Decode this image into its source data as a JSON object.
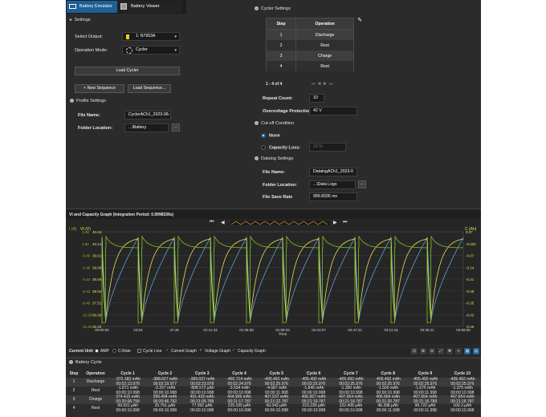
{
  "tabs": [
    {
      "label": "Battery Emulator",
      "active": true
    },
    {
      "label": "Battery Viewer",
      "active": false
    }
  ],
  "left": {
    "settings_header": "Settings",
    "select_output_label": "Select Output:",
    "select_output_value": "1: N7953A",
    "operation_mode_label": "Operation Mode:",
    "operation_mode_value": "Cycler",
    "load_cycler": "Load Cycler",
    "new_sequence": "+ New Sequence",
    "load_sequence": "Load Sequence...",
    "profile_settings": "Profile Settings",
    "file_name_label": "File Name:",
    "file_name_value": "CyclerACh1_2023-06-",
    "folder_location_label": "Folder Location:",
    "folder_location_value": "...\\Battery",
    "browse": "..."
  },
  "cycler": {
    "header": "Cycler Settings",
    "columns": [
      "Step",
      "Operation"
    ],
    "rows": [
      [
        "1",
        "Discharge"
      ],
      [
        "2",
        "Rest"
      ],
      [
        "3",
        "Charge"
      ],
      [
        "4",
        "Rest"
      ]
    ],
    "pager_text": "1 - 4 of 4",
    "repeat_count_label": "Repeat Count:",
    "repeat_count_value": "10",
    "overvoltage_label": "Overvoltage Protection:",
    "overvoltage_value": "42 V",
    "cutoff_header": "Cut-off Condition",
    "none_label": "None",
    "capacity_loss_label": "Capacity Loss:",
    "capacity_loss_value": "10 %",
    "datalog_header": "Datalog Settings",
    "dl_file_name_label": "File Name:",
    "dl_file_name_value": "DatalogACh1_2023-0",
    "dl_folder_label": "Folder Location:",
    "dl_folder_value": "...\\Data Logs",
    "file_save_rate_label": "File Save Rate",
    "file_save_rate_value": "999.8336 ms"
  },
  "graph": {
    "title": "VI and Capacity Graph (Integration Period: 0.9998336s)",
    "left_axis_1_title": "I (A)",
    "left_axis_2_title": "Vt (V)",
    "right_axis_title": "C (Ah)",
    "i_ticks": [
      "3.48",
      "1.50",
      "-0.48",
      "-2.46",
      "-4.44",
      "-6.42",
      "-8.40",
      "-10.38",
      "-11.92"
    ],
    "v_ticks": [
      "40.66",
      "40.14",
      "39.61",
      "39.09",
      "38.56",
      "38.04",
      "37.51",
      "36.99",
      "36.49"
    ],
    "c_ticks": [
      "0.07",
      "-0.002",
      "-0.07",
      "-0.14",
      "-0.21",
      "-0.28",
      "-0.35",
      "-0.42",
      "-0.46"
    ],
    "x_ticks": [
      "00:00:00",
      "23:04",
      "47:49",
      "01:11:43",
      "01:35:38",
      "01:59:33",
      "02:23:27",
      "02:47:21",
      "03:11:16",
      "03:35:11",
      "03:59:05"
    ],
    "x_label": "Time",
    "colors": {
      "current": "#7fc31e",
      "voltage": "#e3e05a",
      "capacity": "#5a9fd8"
    }
  },
  "legend": {
    "current_unit_label": "Current Unit:",
    "amp": "AMP",
    "crate": "C-Rate",
    "cycle_line": "Cycle Line",
    "current_graph": "Current Graph",
    "voltage_graph": "Voltage Graph",
    "capacity_graph": "Capacity Graph"
  },
  "battery_cycle": {
    "header": "Battery Cycle",
    "columns": [
      "Step",
      "Operation",
      "Cycle 1",
      "Cycle 2",
      "Cycle 3",
      "Cycle 4",
      "Cycle 5",
      "Cycle 6",
      "Cycle 7",
      "Cycle 8",
      "Cycle 9",
      "Cycle 10"
    ],
    "rows": [
      {
        "step": "1",
        "op": "Discharge",
        "cells": [
          [
            "-372.183 mAh",
            "00:02:13.978"
          ],
          [
            "-388.627 mAh",
            "00:02:19.977"
          ],
          [
            "-399.037 mAh",
            "00:02:23.978"
          ],
          [
            "-402.714 mAh",
            "00:02:24.976"
          ],
          [
            "-405.492 mAh",
            "00:02:25.976"
          ],
          [
            "-405.492 mAh",
            "00:02:25.976"
          ],
          [
            "-405.492 mAh",
            "00:02:25.976"
          ],
          [
            "-405.492 mAh",
            "00:02:25.976"
          ],
          [
            "-405.492 mAh",
            "00:02:25.976"
          ],
          [
            "-405.492 mAh",
            "00:02:25.976"
          ]
        ]
      },
      {
        "step": "2",
        "op": "Rest",
        "cells": [
          [
            "-1.871 mAh",
            "00:00:10.998"
          ],
          [
            "-3.257 mAh",
            "00:00:10.998"
          ],
          [
            "-808.572 µAh",
            "00:00:10.998"
          ],
          [
            "-3.534 mAh",
            "00:00:10.998"
          ],
          [
            "-4.687 mAh",
            "00:00:11.998"
          ],
          [
            "-1.845 mAh",
            "00:00:10.998"
          ],
          [
            "-1.350 mAh",
            "00:00:10.998"
          ],
          [
            "-1.500 mAh",
            "00:00:10.998"
          ],
          [
            "-1.675 mAh",
            "00:00:11.998"
          ],
          [
            "-1.375 mAh",
            "00:00:10.998"
          ]
        ]
      },
      {
        "step": "3",
        "op": "Charge",
        "cells": [
          [
            "374.415 mAh",
            "00:20:08.799"
          ],
          [
            "399.494 mAh",
            "00:20:46.792"
          ],
          [
            "401.418 mAh",
            "00:21:09.789"
          ],
          [
            "404.999 mAh",
            "00:21:17.787"
          ],
          [
            "407.537 mAh",
            "00:21:22.787"
          ],
          [
            "406.667 mAh",
            "00:21:19.787"
          ],
          [
            "407.654 mAh",
            "00:21:18.787"
          ],
          [
            "406.664 mAh",
            "00:21:20.787"
          ],
          [
            "407.654 mAh",
            "00:21:16.789"
          ],
          [
            "407.654 mAh",
            "00:21:18.787"
          ]
        ]
      },
      {
        "step": "4",
        "op": "Rest",
        "cells": [
          [
            "99.931 µAh",
            "00:00:10.998"
          ],
          [
            "25.751 µAh",
            "00:00:10.998"
          ],
          [
            "77.992 µAh",
            "00:00:10.998"
          ],
          [
            "225.195 µAh",
            "00:00:10.998"
          ],
          [
            "43.342 µAh",
            "00:00:10.998"
          ],
          [
            "223.239 µAh",
            "00:00:10.998"
          ],
          [
            "222.408 µAh",
            "00:00:10.998"
          ],
          [
            "46.398 µAh",
            "00:00:11.998"
          ],
          [
            "96.722 µAh",
            "00:00:11.998"
          ],
          [
            "100.3 µAh",
            "00:00:10.998"
          ]
        ]
      }
    ]
  }
}
